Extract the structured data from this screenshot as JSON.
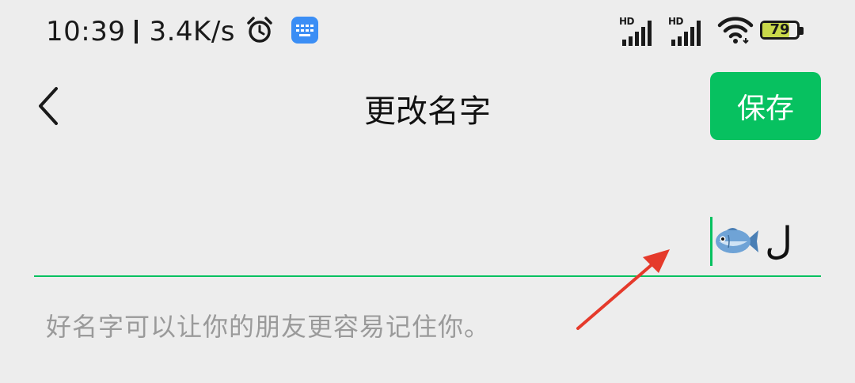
{
  "status_bar": {
    "time": "10:39",
    "separator": "|",
    "network_speed": "3.4K/s",
    "icons": [
      "alarm-icon",
      "keyboard-icon",
      "signal-icon",
      "signal-icon",
      "wifi-icon",
      "battery-icon"
    ],
    "sim1_label": "HD",
    "sim2_label": "HD",
    "battery_level": "79",
    "battery_color": "#c9d94a"
  },
  "nav": {
    "back_icon": "chevron-left-icon",
    "title": "更改名字",
    "save_label": "保存"
  },
  "name_input": {
    "value_emoji": "fish-icon",
    "value_text": "ل"
  },
  "hint": "好名字可以让你的朋友更容易记住你。",
  "annotation": {
    "icon": "red-arrow-icon",
    "color": "#e53a2b"
  },
  "colors": {
    "accent": "#07c160",
    "background": "#ededed",
    "hint_text": "#9a9a9a"
  }
}
